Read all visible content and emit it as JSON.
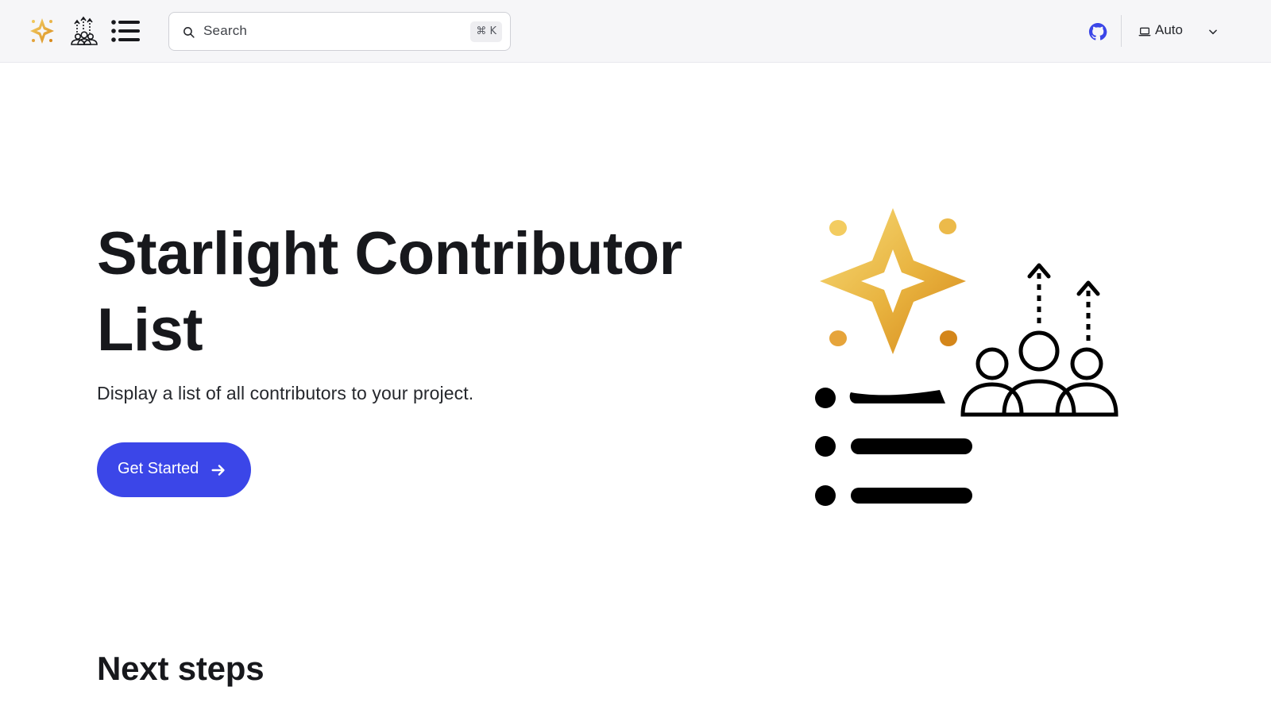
{
  "header": {
    "logo_alt": "Starlight Contributor List",
    "search": {
      "placeholder": "Search",
      "shortcut": "⌘ K"
    },
    "github_label": "GitHub",
    "theme": {
      "selected": "Auto"
    }
  },
  "hero": {
    "title": "Starlight Contributor List",
    "tagline": "Display a list of all contributors to your project.",
    "cta_label": "Get Started"
  },
  "content": {
    "next_steps_heading": "Next steps"
  },
  "colors": {
    "accent": "#3b46e8",
    "header_bg": "#f6f6f8",
    "github_icon": "#3b46e8",
    "star_gold": "#e0a12c"
  },
  "icons": {
    "logo": "star-contributors-list-logo",
    "search": "search-icon",
    "github": "github-icon",
    "theme": "laptop-icon",
    "chevron": "chevron-down-icon",
    "cta_arrow": "arrow-right-icon"
  }
}
